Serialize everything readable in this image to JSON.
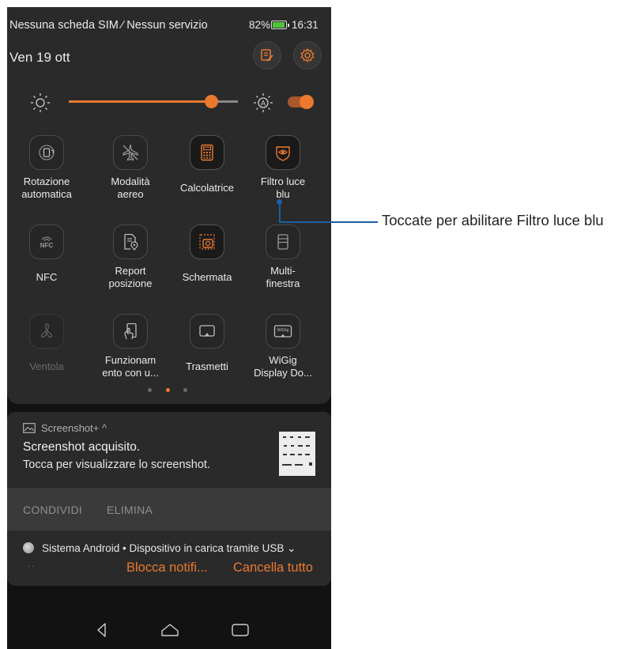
{
  "status_bar": {
    "carrier": "Nessuna scheda SIM ⁄ Nessun servizio",
    "battery": "82%",
    "time": "16:31"
  },
  "header": {
    "date": "Ven 19 ott",
    "edit_icon": "edit-icon",
    "settings_icon": "gear-icon"
  },
  "brightness": {
    "level": 0.84,
    "auto": true,
    "accent": "#e9792f"
  },
  "tiles": [
    {
      "label": "Rotazione automatica",
      "icon": "rotation-icon",
      "active": false
    },
    {
      "label": "Modalità aereo",
      "icon": "airplane-icon",
      "active": false
    },
    {
      "label": "Calcolatrice",
      "icon": "calculator-icon",
      "active": true
    },
    {
      "label": "Filtro luce blu",
      "icon": "eye-filter-icon",
      "active": true
    },
    {
      "label": "NFC",
      "icon": "nfc-icon",
      "active": false
    },
    {
      "label": "Report posizione",
      "icon": "location-report-icon",
      "active": false
    },
    {
      "label": "Schermata",
      "icon": "screenshot-icon",
      "active": true
    },
    {
      "label": "Multi-finestra",
      "icon": "multiwindow-icon",
      "active": false
    },
    {
      "label": "Ventola",
      "icon": "fan-icon",
      "active": false
    },
    {
      "label": "Funzionamento con u...",
      "icon": "one-hand-icon",
      "active": false
    },
    {
      "label": "Trasmetti",
      "icon": "cast-icon",
      "active": false
    },
    {
      "label": "WiGig Display Do...",
      "icon": "wigig-icon",
      "active": false
    }
  ],
  "tile_labels_display": {
    "t0": "Rotazione\nautomatica",
    "t1": "Modalità\naereo",
    "t2": "Calcolatrice",
    "t3": "Filtro luce\nblu",
    "t4": "NFC",
    "t5": "Report\nposizione",
    "t6": "Schermata",
    "t7": "Multi-\nfinestra",
    "t8": "Ventola",
    "t9": "Funzionam\nento con u...",
    "t10": "Trasmetti",
    "t11": "WiGig\nDisplay Do..."
  },
  "pager": {
    "pages": 3,
    "current": 1
  },
  "screenshot_notification": {
    "app": "Screenshot+ ^",
    "title": "Screenshot acquisito.",
    "text": "Tocca per visualizzare lo screenshot.",
    "actions": [
      "CONDIVIDI",
      "ELIMINA"
    ]
  },
  "system_notification": {
    "text": "Sistema Android • Dispositivo in carica tramite USB ⌄",
    "block_label": "Blocca notifi...",
    "clear_label": "Cancella tutto"
  },
  "callout": {
    "text": "Toccate per abilitare Filtro luce blu",
    "color": "#1c5fa8"
  },
  "navigation": {
    "back": "back-icon",
    "home": "home-icon",
    "recents": "recents-icon"
  }
}
